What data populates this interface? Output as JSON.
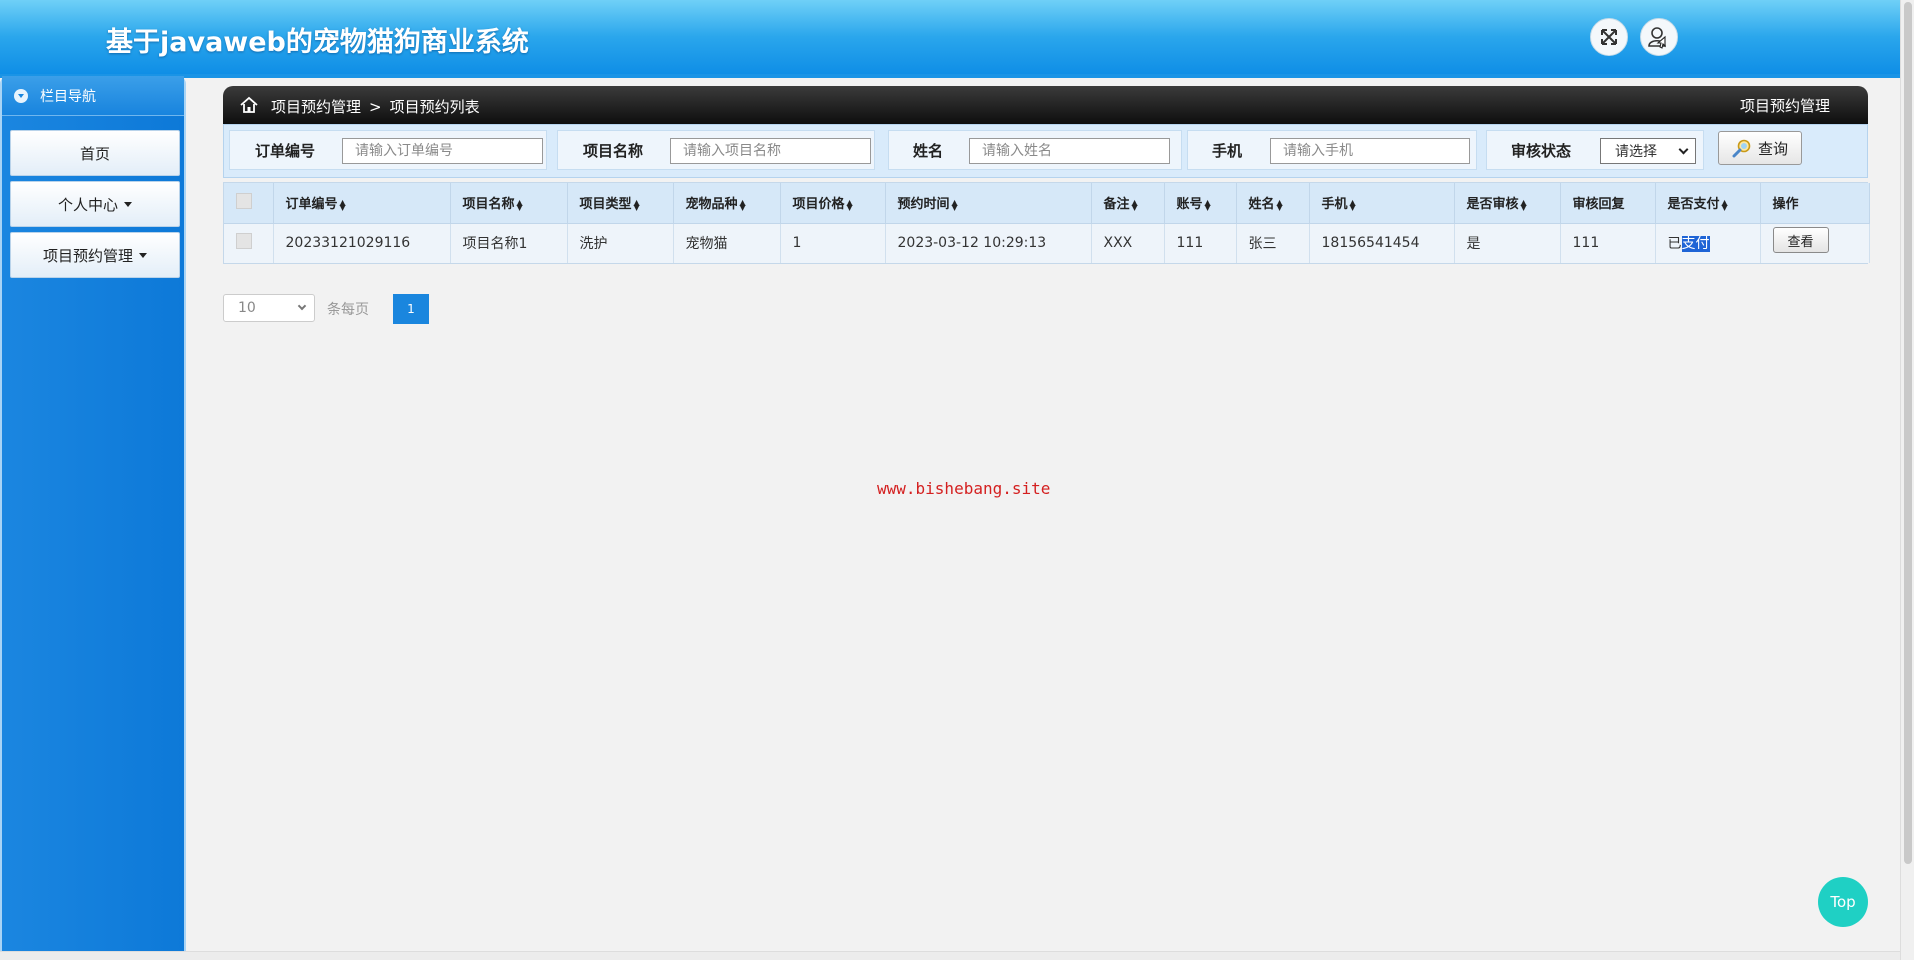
{
  "header": {
    "title": "基于javaweb的宠物猫狗商业系统"
  },
  "sidebar": {
    "heading": "栏目导航",
    "items": [
      {
        "label": "首页"
      },
      {
        "label": "个人中心"
      },
      {
        "label": "项目预约管理"
      }
    ]
  },
  "breadcrumb": {
    "section": "项目预约管理",
    "separator": ">",
    "page": "项目预约列表",
    "right_title": "项目预约管理"
  },
  "search": {
    "fields": [
      {
        "label": "订单编号",
        "placeholder": "请输入订单编号"
      },
      {
        "label": "项目名称",
        "placeholder": "请输入项目名称"
      },
      {
        "label": "姓名",
        "placeholder": "请输入姓名"
      },
      {
        "label": "手机",
        "placeholder": "请输入手机"
      }
    ],
    "status_label": "审核状态",
    "status_selected": "请选择",
    "query_label": "查询"
  },
  "table": {
    "columns": [
      "订单编号",
      "项目名称",
      "项目类型",
      "宠物品种",
      "项目价格",
      "预约时间",
      "备注",
      "账号",
      "姓名",
      "手机",
      "是否审核",
      "审核回复",
      "是否支付",
      "操作"
    ],
    "rows": [
      {
        "order_no": "20233121029116",
        "project_name": "项目名称1",
        "project_type": "洗护",
        "pet_breed": "宠物猫",
        "price": "1",
        "time": "2023-03-12 10:29:13",
        "remark": "XXX",
        "account": "111",
        "name": "张三",
        "phone": "18156541454",
        "reviewed": "是",
        "reply": "111",
        "paid_prefix": "已",
        "paid_highlight": "支付",
        "action": "查看"
      }
    ]
  },
  "pagination": {
    "page_size": "10",
    "per_page_label": "条每页",
    "current_page": "1"
  },
  "watermark": "www.bishebang.site",
  "top_button": "Top"
}
